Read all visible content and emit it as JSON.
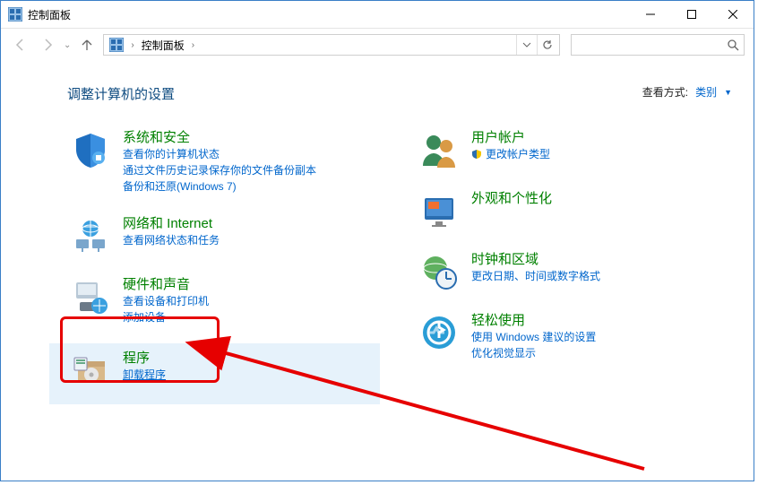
{
  "window": {
    "title": "控制面板"
  },
  "address": {
    "root": "控制面板"
  },
  "search": {
    "placeholder": ""
  },
  "header": {
    "heading": "调整计算机的设置",
    "view_label": "查看方式:",
    "view_value": "类别"
  },
  "left": {
    "security": {
      "title": "系统和安全",
      "l1": "查看你的计算机状态",
      "l2": "通过文件历史记录保存你的文件备份副本",
      "l3": "备份和还原(Windows 7)"
    },
    "network": {
      "title": "网络和 Internet",
      "l1": "查看网络状态和任务"
    },
    "hardware": {
      "title": "硬件和声音",
      "l1": "查看设备和打印机",
      "l2": "添加设备"
    },
    "programs": {
      "title": "程序",
      "l1": "卸载程序"
    }
  },
  "right": {
    "accounts": {
      "title": "用户帐户",
      "l1": "更改帐户类型"
    },
    "appearance": {
      "title": "外观和个性化"
    },
    "clock": {
      "title": "时钟和区域",
      "l1": "更改日期、时间或数字格式"
    },
    "ease": {
      "title": "轻松使用",
      "l1": "使用 Windows 建议的设置",
      "l2": "优化视觉显示"
    }
  }
}
